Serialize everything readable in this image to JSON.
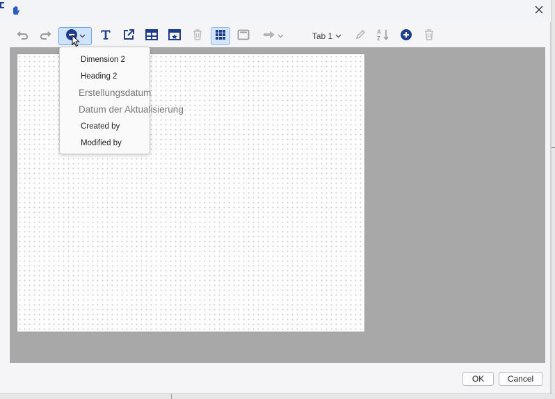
{
  "dialog": {
    "close_icon": "close-icon",
    "app_icon": "hand-icon"
  },
  "toolbar": {
    "undo_icon": "undo-icon",
    "redo_icon": "redo-icon",
    "add_field_icon": "add-field-icon",
    "text_icon": "text-icon",
    "link_icon": "external-link-icon",
    "table_icon": "table-icon",
    "calendar_icon": "calendar-icon",
    "delete_icon": "trash-icon",
    "grid_icon": "grid-icon",
    "panel_icon": "panel-icon",
    "arrow_icon": "arrow-right-icon",
    "tab_selector": "Tab 1",
    "edit_icon": "pencil-icon",
    "sort_icon": "sort-icon",
    "add_icon": "plus-circle-icon",
    "remove_icon": "trash-icon"
  },
  "menu": {
    "items": [
      "Dimension 2",
      "Heading 2",
      "Erstellungsdatum",
      "Datum der Aktualisierung",
      "Created by",
      "Modified by"
    ]
  },
  "footer": {
    "ok_label": "OK",
    "cancel_label": "Cancel"
  },
  "colors": {
    "accent": "#1d3d8c",
    "workspace_bg": "#a8a8a8",
    "canvas_bg": "#ffffff"
  }
}
